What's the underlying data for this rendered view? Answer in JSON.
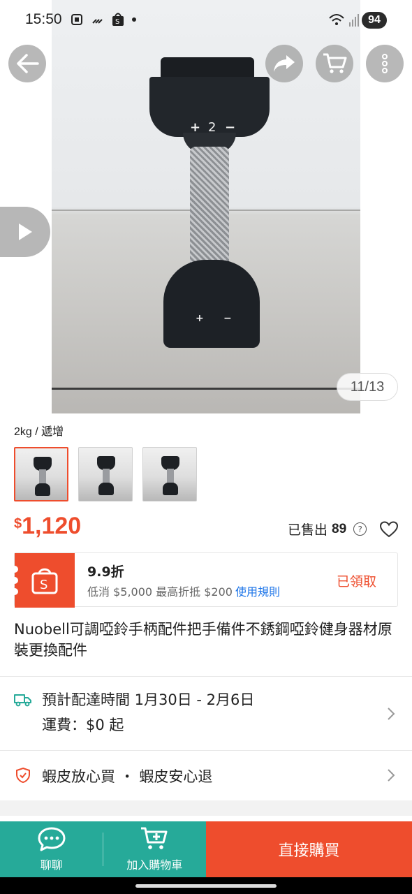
{
  "status_bar": {
    "time": "15:50",
    "battery": "94"
  },
  "gallery": {
    "counter": "11/13",
    "image_text": {
      "top_plus": "+",
      "top_number": "2",
      "top_minus": "−",
      "bottom_plus": "+",
      "bottom_minus": "−"
    }
  },
  "variant": {
    "label": "2kg / 遞增"
  },
  "price": {
    "currency": "$",
    "amount": "1,120"
  },
  "sold": {
    "label": "已售出",
    "count": "89",
    "help": "?"
  },
  "voucher": {
    "title": "9.9折",
    "min_spend": "低消 $5,000 最高折抵 $200",
    "rules_link": "使用規則",
    "status": "已領取"
  },
  "product": {
    "title": "Nuobell可調啞鈴手柄配件把手備件不銹鋼啞鈴健身器材原裝更換配件"
  },
  "shipping": {
    "eta": "預計配達時間 1月30日 - 2月6日",
    "fee": "運費：$0 起"
  },
  "guarantee": {
    "text": "蝦皮放心買 ・ 蝦皮安心退"
  },
  "bottom_bar": {
    "chat_label": "聊聊",
    "cart_label": "加入購物車",
    "buy_label": "直接購買"
  },
  "colors": {
    "brand": "#ee4d2d",
    "teal": "#26aa99",
    "link": "#1a73e8"
  }
}
